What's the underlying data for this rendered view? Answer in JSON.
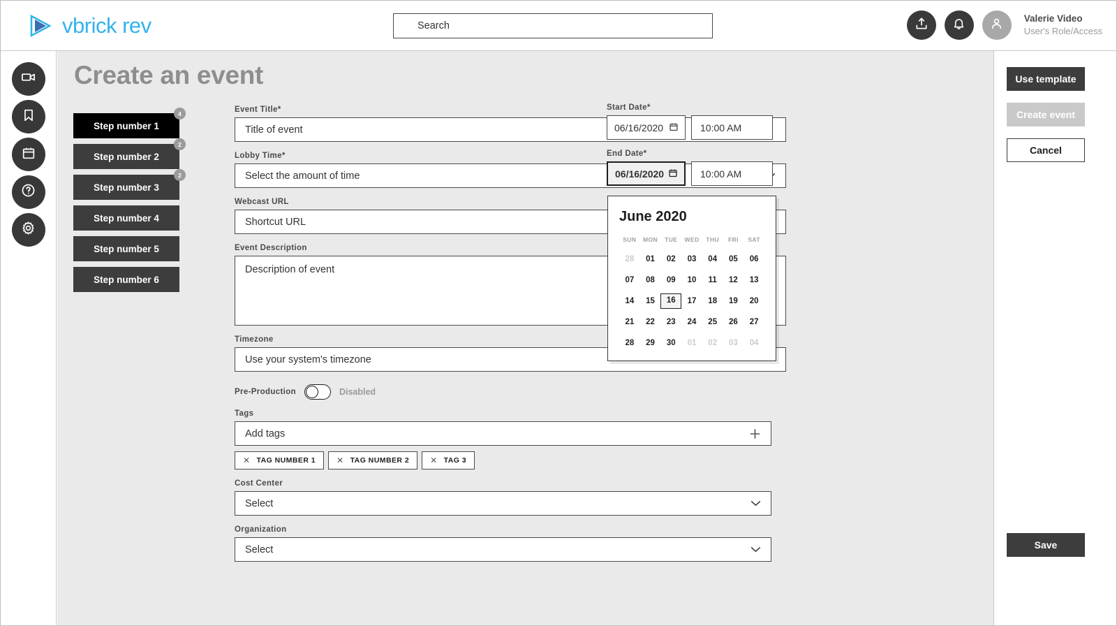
{
  "header": {
    "logo_text": "vbrick rev",
    "logo_icon": "play-triangle-icon",
    "search_placeholder": "Search",
    "upload_icon": "upload-icon",
    "notification_icon": "bell-icon",
    "avatar_icon": "person-icon",
    "user_name": "Valerie Video",
    "user_role": "User's Role/Access",
    "accent_color": "#34b3ec"
  },
  "rail": {
    "items": [
      {
        "icon": "video-camera-icon",
        "name": "videos"
      },
      {
        "icon": "bookmark-icon",
        "name": "bookmarks"
      },
      {
        "icon": "calendar-icon",
        "name": "events"
      },
      {
        "icon": "question-circle-icon",
        "name": "help"
      },
      {
        "icon": "gear-icon",
        "name": "settings"
      }
    ]
  },
  "page": {
    "title": "Create an event"
  },
  "steps": [
    {
      "label": "Step number 1",
      "badge": "4",
      "active": true
    },
    {
      "label": "Step number 2",
      "badge": "2",
      "active": false
    },
    {
      "label": "Step number 3",
      "badge": "2",
      "active": false
    },
    {
      "label": "Step number 4",
      "badge": "",
      "active": false
    },
    {
      "label": "Step number 5",
      "badge": "",
      "active": false
    },
    {
      "label": "Step number 6",
      "badge": "",
      "active": false
    }
  ],
  "form": {
    "event_title": {
      "label": "Event Title*",
      "value": "Title of event"
    },
    "lobby_time": {
      "label": "Lobby Time*",
      "value": "Select the amount of time",
      "chevron": "chevron-down-icon"
    },
    "webcast_url": {
      "label": "Webcast URL",
      "value": "Shortcut URL"
    },
    "event_description": {
      "label": "Event Description",
      "value": "Description of event"
    },
    "timezone": {
      "label": "Timezone",
      "value": "Use your system's timezone"
    },
    "pre_production": {
      "label": "Pre-Production",
      "state": "Disabled",
      "enabled": false
    },
    "tags": {
      "label": "Tags",
      "value": "Add tags",
      "add_icon": "plus-icon",
      "chips": [
        "TAG NUMBER 1",
        "TAG NUMBER 2",
        "TAG 3"
      ],
      "chip_remove_icon": "close-x-icon"
    },
    "cost_center": {
      "label": "Cost Center",
      "value": "Select",
      "chevron": "chevron-down-icon"
    },
    "organization": {
      "label": "Organization",
      "value": "Select",
      "chevron": "chevron-down-icon"
    }
  },
  "dates": {
    "start": {
      "label": "Start Date*",
      "date": "06/16/2020",
      "time": "10:00 AM",
      "icon": "calendar-icon"
    },
    "end": {
      "label": "End Date*",
      "date": "06/16/2020",
      "time": "10:00 AM",
      "icon": "calendar-icon"
    }
  },
  "calendar": {
    "title": "June 2020",
    "dow": [
      "SUN",
      "MON",
      "TUE",
      "WED",
      "THU",
      "FRI",
      "SAT"
    ],
    "weeks": [
      [
        {
          "d": "28",
          "mute": true
        },
        {
          "d": "01"
        },
        {
          "d": "02"
        },
        {
          "d": "03"
        },
        {
          "d": "04"
        },
        {
          "d": "05"
        },
        {
          "d": "06"
        }
      ],
      [
        {
          "d": "07"
        },
        {
          "d": "08"
        },
        {
          "d": "09"
        },
        {
          "d": "10"
        },
        {
          "d": "11"
        },
        {
          "d": "12"
        },
        {
          "d": "13"
        }
      ],
      [
        {
          "d": "14"
        },
        {
          "d": "15"
        },
        {
          "d": "16",
          "sel": true
        },
        {
          "d": "17"
        },
        {
          "d": "18"
        },
        {
          "d": "19"
        },
        {
          "d": "20"
        }
      ],
      [
        {
          "d": "21"
        },
        {
          "d": "22"
        },
        {
          "d": "23"
        },
        {
          "d": "24"
        },
        {
          "d": "25"
        },
        {
          "d": "26"
        },
        {
          "d": "27"
        }
      ],
      [
        {
          "d": "28"
        },
        {
          "d": "29"
        },
        {
          "d": "30"
        },
        {
          "d": "01",
          "mute": true
        },
        {
          "d": "02",
          "mute": true
        },
        {
          "d": "03",
          "mute": true
        },
        {
          "d": "04",
          "mute": true
        }
      ]
    ]
  },
  "right_panel": {
    "use_template": "Use template",
    "create_event": "Create event",
    "cancel": "Cancel",
    "save": "Save"
  }
}
